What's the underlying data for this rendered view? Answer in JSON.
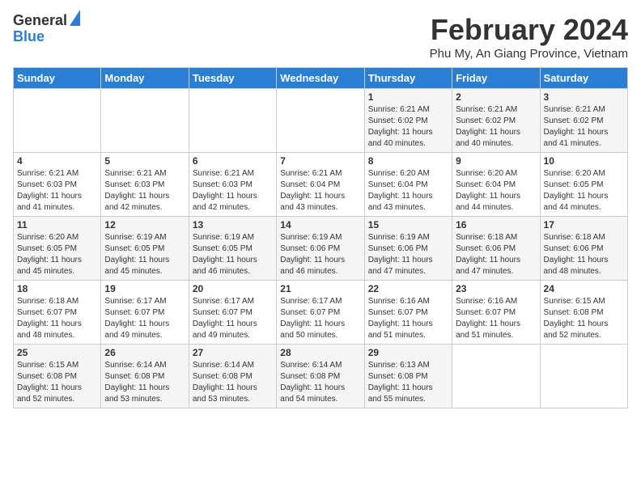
{
  "header": {
    "logo_line1": "General",
    "logo_line2": "Blue",
    "month": "February 2024",
    "location": "Phu My, An Giang Province, Vietnam"
  },
  "weekdays": [
    "Sunday",
    "Monday",
    "Tuesday",
    "Wednesday",
    "Thursday",
    "Friday",
    "Saturday"
  ],
  "weeks": [
    [
      {
        "day": "",
        "info": ""
      },
      {
        "day": "",
        "info": ""
      },
      {
        "day": "",
        "info": ""
      },
      {
        "day": "",
        "info": ""
      },
      {
        "day": "1",
        "info": "Sunrise: 6:21 AM\nSunset: 6:02 PM\nDaylight: 11 hours\nand 40 minutes."
      },
      {
        "day": "2",
        "info": "Sunrise: 6:21 AM\nSunset: 6:02 PM\nDaylight: 11 hours\nand 40 minutes."
      },
      {
        "day": "3",
        "info": "Sunrise: 6:21 AM\nSunset: 6:02 PM\nDaylight: 11 hours\nand 41 minutes."
      }
    ],
    [
      {
        "day": "4",
        "info": "Sunrise: 6:21 AM\nSunset: 6:03 PM\nDaylight: 11 hours\nand 41 minutes."
      },
      {
        "day": "5",
        "info": "Sunrise: 6:21 AM\nSunset: 6:03 PM\nDaylight: 11 hours\nand 42 minutes."
      },
      {
        "day": "6",
        "info": "Sunrise: 6:21 AM\nSunset: 6:03 PM\nDaylight: 11 hours\nand 42 minutes."
      },
      {
        "day": "7",
        "info": "Sunrise: 6:21 AM\nSunset: 6:04 PM\nDaylight: 11 hours\nand 43 minutes."
      },
      {
        "day": "8",
        "info": "Sunrise: 6:20 AM\nSunset: 6:04 PM\nDaylight: 11 hours\nand 43 minutes."
      },
      {
        "day": "9",
        "info": "Sunrise: 6:20 AM\nSunset: 6:04 PM\nDaylight: 11 hours\nand 44 minutes."
      },
      {
        "day": "10",
        "info": "Sunrise: 6:20 AM\nSunset: 6:05 PM\nDaylight: 11 hours\nand 44 minutes."
      }
    ],
    [
      {
        "day": "11",
        "info": "Sunrise: 6:20 AM\nSunset: 6:05 PM\nDaylight: 11 hours\nand 45 minutes."
      },
      {
        "day": "12",
        "info": "Sunrise: 6:19 AM\nSunset: 6:05 PM\nDaylight: 11 hours\nand 45 minutes."
      },
      {
        "day": "13",
        "info": "Sunrise: 6:19 AM\nSunset: 6:05 PM\nDaylight: 11 hours\nand 46 minutes."
      },
      {
        "day": "14",
        "info": "Sunrise: 6:19 AM\nSunset: 6:06 PM\nDaylight: 11 hours\nand 46 minutes."
      },
      {
        "day": "15",
        "info": "Sunrise: 6:19 AM\nSunset: 6:06 PM\nDaylight: 11 hours\nand 47 minutes."
      },
      {
        "day": "16",
        "info": "Sunrise: 6:18 AM\nSunset: 6:06 PM\nDaylight: 11 hours\nand 47 minutes."
      },
      {
        "day": "17",
        "info": "Sunrise: 6:18 AM\nSunset: 6:06 PM\nDaylight: 11 hours\nand 48 minutes."
      }
    ],
    [
      {
        "day": "18",
        "info": "Sunrise: 6:18 AM\nSunset: 6:07 PM\nDaylight: 11 hours\nand 48 minutes."
      },
      {
        "day": "19",
        "info": "Sunrise: 6:17 AM\nSunset: 6:07 PM\nDaylight: 11 hours\nand 49 minutes."
      },
      {
        "day": "20",
        "info": "Sunrise: 6:17 AM\nSunset: 6:07 PM\nDaylight: 11 hours\nand 49 minutes."
      },
      {
        "day": "21",
        "info": "Sunrise: 6:17 AM\nSunset: 6:07 PM\nDaylight: 11 hours\nand 50 minutes."
      },
      {
        "day": "22",
        "info": "Sunrise: 6:16 AM\nSunset: 6:07 PM\nDaylight: 11 hours\nand 51 minutes."
      },
      {
        "day": "23",
        "info": "Sunrise: 6:16 AM\nSunset: 6:07 PM\nDaylight: 11 hours\nand 51 minutes."
      },
      {
        "day": "24",
        "info": "Sunrise: 6:15 AM\nSunset: 6:08 PM\nDaylight: 11 hours\nand 52 minutes."
      }
    ],
    [
      {
        "day": "25",
        "info": "Sunrise: 6:15 AM\nSunset: 6:08 PM\nDaylight: 11 hours\nand 52 minutes."
      },
      {
        "day": "26",
        "info": "Sunrise: 6:14 AM\nSunset: 6:08 PM\nDaylight: 11 hours\nand 53 minutes."
      },
      {
        "day": "27",
        "info": "Sunrise: 6:14 AM\nSunset: 6:08 PM\nDaylight: 11 hours\nand 53 minutes."
      },
      {
        "day": "28",
        "info": "Sunrise: 6:14 AM\nSunset: 6:08 PM\nDaylight: 11 hours\nand 54 minutes."
      },
      {
        "day": "29",
        "info": "Sunrise: 6:13 AM\nSunset: 6:08 PM\nDaylight: 11 hours\nand 55 minutes."
      },
      {
        "day": "",
        "info": ""
      },
      {
        "day": "",
        "info": ""
      }
    ]
  ]
}
